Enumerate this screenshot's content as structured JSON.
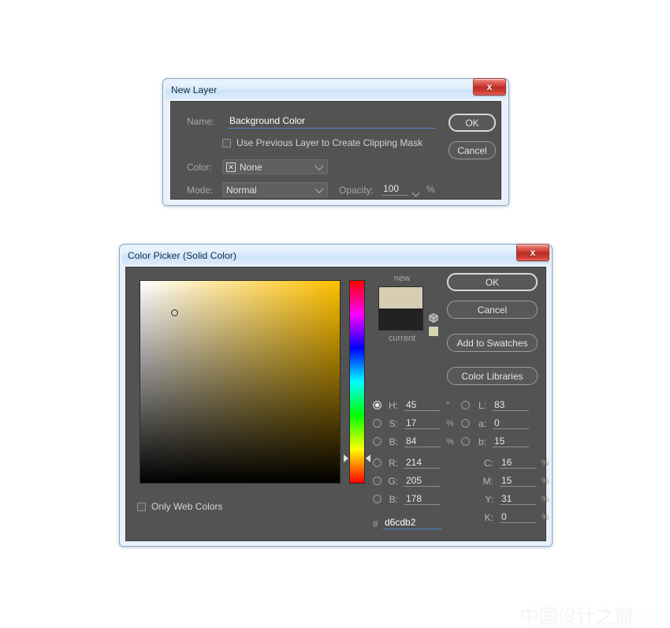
{
  "new_layer_dialog": {
    "title": "New Layer",
    "close_label": "x",
    "name_label": "Name:",
    "name_value": "Background Color",
    "clipping_mask_label": "Use Previous Layer to Create Clipping Mask",
    "clipping_mask_checked": false,
    "color_label": "Color:",
    "color_value": "None",
    "color_swatch_glyph": "✕",
    "mode_label": "Mode:",
    "mode_value": "Normal",
    "opacity_label": "Opacity:",
    "opacity_value": "100",
    "opacity_unit": "%",
    "ok_label": "OK",
    "cancel_label": "Cancel"
  },
  "color_picker_dialog": {
    "title": "Color Picker (Solid Color)",
    "close_label": "x",
    "buttons": {
      "ok": "OK",
      "cancel": "Cancel",
      "add_to_swatches": "Add to Swatches",
      "color_libraries": "Color Libraries"
    },
    "preview": {
      "new_label": "new",
      "current_label": "current",
      "new_color": "#d6cdb2",
      "current_color": "#222222",
      "websafe_color": "#d6d6a8"
    },
    "only_web_colors_label": "Only Web Colors",
    "only_web_colors_checked": false,
    "selected_model": "H",
    "hsb": [
      {
        "key": "H",
        "label": "H:",
        "value": "45",
        "unit": "°",
        "selected": true
      },
      {
        "key": "S",
        "label": "S:",
        "value": "17",
        "unit": "%",
        "selected": false
      },
      {
        "key": "B",
        "label": "B:",
        "value": "84",
        "unit": "%",
        "selected": false
      }
    ],
    "rgb": [
      {
        "key": "R",
        "label": "R:",
        "value": "214",
        "unit": "",
        "selected": false
      },
      {
        "key": "G",
        "label": "G:",
        "value": "205",
        "unit": "",
        "selected": false
      },
      {
        "key": "B",
        "label": "B:",
        "value": "178",
        "unit": "",
        "selected": false
      }
    ],
    "lab": [
      {
        "key": "L",
        "label": "L:",
        "value": "83",
        "unit": "",
        "selected": false
      },
      {
        "key": "a",
        "label": "a:",
        "value": "0",
        "unit": "",
        "selected": false
      },
      {
        "key": "b",
        "label": "b:",
        "value": "15",
        "unit": "",
        "selected": false
      }
    ],
    "cmyk": [
      {
        "key": "C",
        "label": "C:",
        "value": "16",
        "unit": "%"
      },
      {
        "key": "M",
        "label": "M:",
        "value": "15",
        "unit": "%"
      },
      {
        "key": "Y",
        "label": "Y:",
        "value": "31",
        "unit": "%"
      },
      {
        "key": "K",
        "label": "K:",
        "value": "0",
        "unit": "%"
      }
    ],
    "hex_prefix": "#",
    "hex_value": "d6cdb2",
    "sb_field": {
      "hue_color": "#ffc000",
      "cursor_saturation_pct": 17,
      "cursor_brightness_pct": 84,
      "hue_marker_pct": 87.5
    }
  },
  "watermark": {
    "cjk": "中国设计之窗",
    "line1": "中国设计",
    "line2": "SJ.COM"
  }
}
